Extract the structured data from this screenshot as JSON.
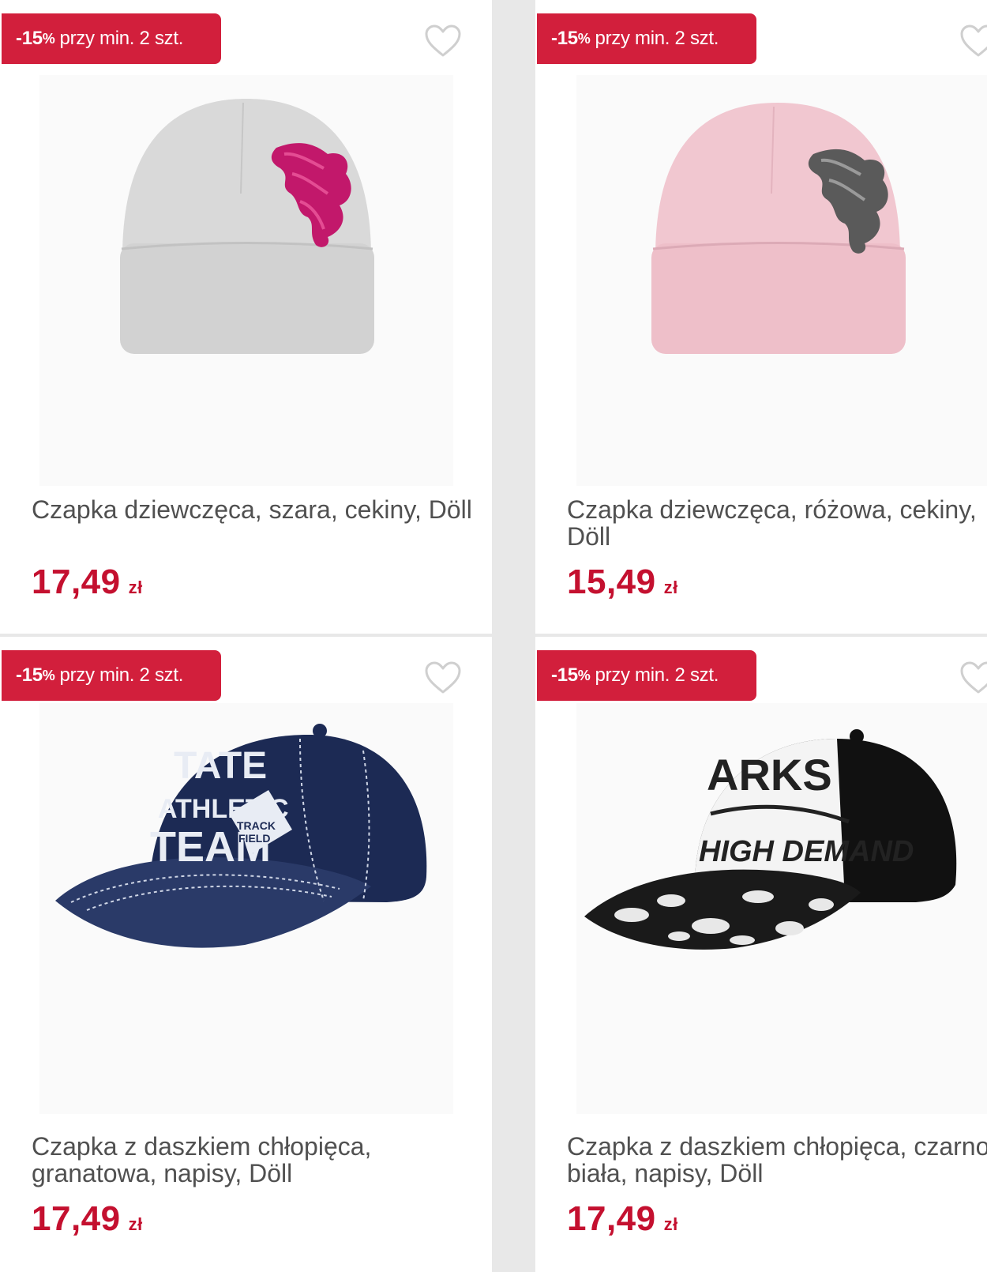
{
  "products": [
    {
      "badge_value": "-15",
      "badge_pct": "%",
      "badge_text": "przy min. 2 szt.",
      "title": "Czapka dziewczęca, szara, cekiny, Döll",
      "price": "17,49",
      "currency": "zł",
      "image": "grey-beanie-pink-sequin-snake"
    },
    {
      "badge_value": "-15",
      "badge_pct": "%",
      "badge_text": "przy min. 2 szt.",
      "title": "Czapka dziewczęca, różowa, cekiny, Döll",
      "price": "15,49",
      "currency": "zł",
      "image": "pink-beanie-silver-sequin-snake"
    },
    {
      "badge_value": "-15",
      "badge_pct": "%",
      "badge_text": "przy min. 2 szt.",
      "title": "Czapka z daszkiem chłopięca, granatowa, napisy, Döll",
      "price": "17,49",
      "currency": "zł",
      "image": "navy-baseball-cap"
    },
    {
      "badge_value": "-15",
      "badge_pct": "%",
      "badge_text": "przy min. 2 szt.",
      "title": "Czapka z daszkiem chłopięca, czarno-biała, napisy, Döll",
      "price": "17,49",
      "currency": "zł",
      "image": "black-white-baseball-cap"
    }
  ],
  "colors": {
    "accent": "#d21f3c",
    "price": "#c4102f",
    "title": "#505050"
  },
  "icons": {
    "wishlist": "heart-outline-icon"
  }
}
